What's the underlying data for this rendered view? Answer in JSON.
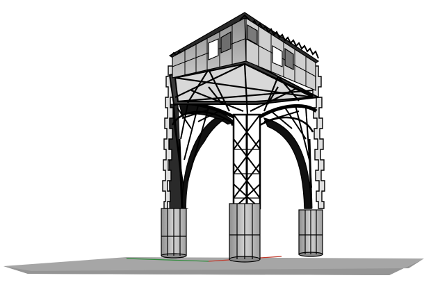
{
  "viewport": {
    "background": "#ffffff",
    "ground_plane_color": "#a9a9a9",
    "axis_x_color": "#c0392b",
    "axis_y_color": "#2e8b3a",
    "wireframe_color": "#000000",
    "surface_light": "#e6e6e6",
    "surface_mid": "#c9c9c9",
    "surface_dark": "#9a9a9a"
  }
}
